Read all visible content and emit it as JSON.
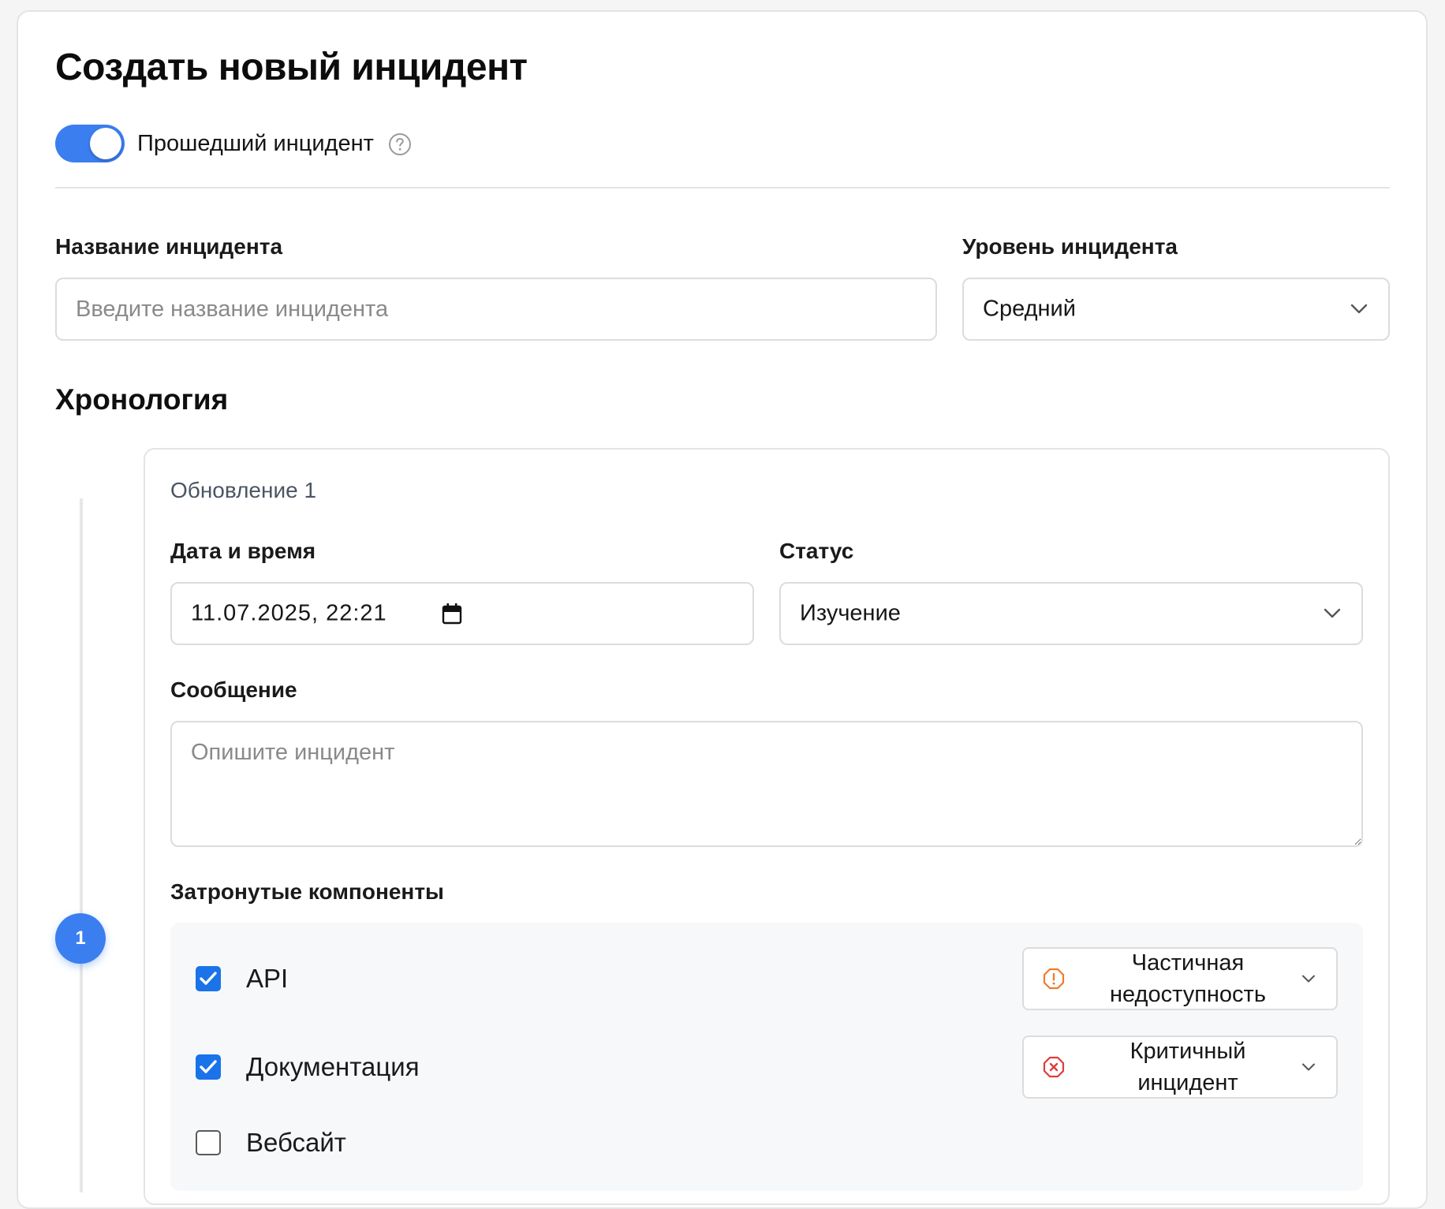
{
  "page": {
    "title": "Создать новый инцидент"
  },
  "past_incident": {
    "label": "Прошедший инцидент",
    "enabled": true
  },
  "incident_name": {
    "label": "Название инцидента",
    "placeholder": "Введите название инцидента",
    "value": ""
  },
  "incident_level": {
    "label": "Уровень инцидента",
    "value": "Средний"
  },
  "timeline": {
    "title": "Хронология",
    "marker": "1",
    "update": {
      "title": "Обновление 1",
      "datetime_label": "Дата и время",
      "datetime_value": "11.07.2025, 22:21",
      "status_label": "Статус",
      "status_value": "Изучение",
      "message_label": "Сообщение",
      "message_placeholder": "Опишите инцидент",
      "components_label": "Затронутые компоненты",
      "components": [
        {
          "name": "API",
          "checked": true,
          "impact": "Частичная недоступность",
          "impact_icon": "warning-octagon-icon",
          "impact_color": "#f07b2c"
        },
        {
          "name": "Документация",
          "checked": true,
          "impact": "Критичный инцидент",
          "impact_icon": "error-octagon-icon",
          "impact_color": "#e23b3b"
        },
        {
          "name": "Вебсайт",
          "checked": false
        }
      ]
    }
  },
  "colors": {
    "accent": "#3b7ef0",
    "checkbox": "#1a73e8",
    "muted_text": "#4b5563"
  }
}
